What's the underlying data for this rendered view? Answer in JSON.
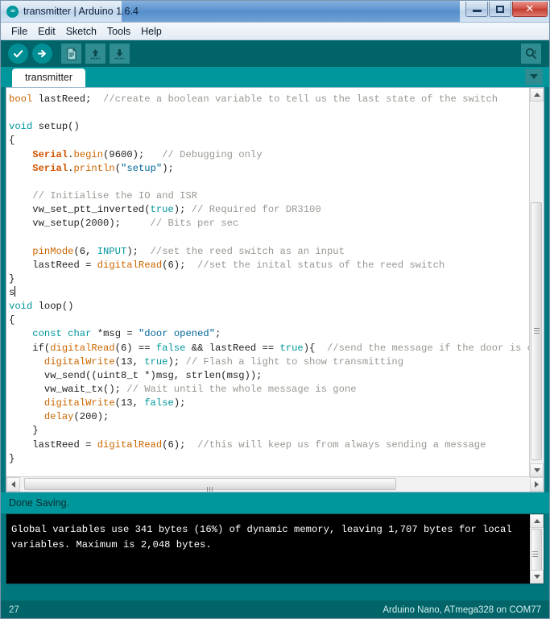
{
  "window": {
    "title": "transmitter | Arduino 1.6.4",
    "logo_icon": "arduino-infinity-logo",
    "minimize_label": "Minimize",
    "maximize_label": "Maximize",
    "close_label": "Close",
    "close_glyph": "✕"
  },
  "menubar": {
    "items": [
      {
        "label": "File"
      },
      {
        "label": "Edit"
      },
      {
        "label": "Sketch"
      },
      {
        "label": "Tools"
      },
      {
        "label": "Help"
      }
    ]
  },
  "toolbar": {
    "buttons": [
      {
        "name": "verify-button",
        "icon": "checkmark-icon",
        "tooltip": "Verify"
      },
      {
        "name": "upload-button",
        "icon": "right-arrow-icon",
        "tooltip": "Upload"
      },
      {
        "name": "new-button",
        "icon": "new-document-icon",
        "tooltip": "New"
      },
      {
        "name": "open-button",
        "icon": "up-arrow-icon",
        "tooltip": "Open"
      },
      {
        "name": "save-button",
        "icon": "down-arrow-icon",
        "tooltip": "Save"
      }
    ],
    "serial_monitor": {
      "icon": "magnifier-icon",
      "tooltip": "Serial Monitor"
    }
  },
  "tabs": {
    "items": [
      {
        "label": "transmitter",
        "active": true
      }
    ],
    "menu_icon": "chevron-down-icon"
  },
  "editor": {
    "lines": [
      [
        {
          "t": "bool",
          "c": "kw"
        },
        {
          "t": " lastReed;  ",
          "c": "plain"
        },
        {
          "t": "//create a boolean variable to tell us the last state of the switch",
          "c": "cmt"
        }
      ],
      [],
      [
        {
          "t": "void",
          "c": "kw2"
        },
        {
          "t": " setup()",
          "c": "plain"
        }
      ],
      [
        {
          "t": "{",
          "c": "plain"
        }
      ],
      [
        {
          "t": "    ",
          "c": "plain"
        },
        {
          "t": "Serial",
          "c": "fn"
        },
        {
          "t": ".",
          "c": "plain"
        },
        {
          "t": "begin",
          "c": "fnm"
        },
        {
          "t": "(9600);   ",
          "c": "plain"
        },
        {
          "t": "// Debugging only",
          "c": "cmt"
        }
      ],
      [
        {
          "t": "    ",
          "c": "plain"
        },
        {
          "t": "Serial",
          "c": "fn"
        },
        {
          "t": ".",
          "c": "plain"
        },
        {
          "t": "println",
          "c": "fnm"
        },
        {
          "t": "(",
          "c": "plain"
        },
        {
          "t": "\"setup\"",
          "c": "str"
        },
        {
          "t": ");",
          "c": "plain"
        }
      ],
      [],
      [
        {
          "t": "    ",
          "c": "plain"
        },
        {
          "t": "// Initialise the IO and ISR",
          "c": "cmt"
        }
      ],
      [
        {
          "t": "    vw_set_ptt_inverted(",
          "c": "plain"
        },
        {
          "t": "true",
          "c": "kw2"
        },
        {
          "t": "); ",
          "c": "plain"
        },
        {
          "t": "// Required for DR3100",
          "c": "cmt"
        }
      ],
      [
        {
          "t": "    vw_setup(2000);     ",
          "c": "plain"
        },
        {
          "t": "// Bits per sec",
          "c": "cmt"
        }
      ],
      [],
      [
        {
          "t": "    ",
          "c": "plain"
        },
        {
          "t": "pinMode",
          "c": "kw"
        },
        {
          "t": "(6, ",
          "c": "plain"
        },
        {
          "t": "INPUT",
          "c": "kw2"
        },
        {
          "t": ");  ",
          "c": "plain"
        },
        {
          "t": "//set the reed switch as an input",
          "c": "cmt"
        }
      ],
      [
        {
          "t": "    lastReed = ",
          "c": "plain"
        },
        {
          "t": "digitalRead",
          "c": "kw"
        },
        {
          "t": "(6);  ",
          "c": "plain"
        },
        {
          "t": "//set the inital status of the reed switch",
          "c": "cmt"
        }
      ],
      [
        {
          "t": "}",
          "c": "plain"
        }
      ],
      [
        {
          "t": "s",
          "c": "plain"
        },
        {
          "t": "|CARET|",
          "c": "caret"
        }
      ],
      [
        {
          "t": "void",
          "c": "kw2"
        },
        {
          "t": " loop()",
          "c": "plain"
        }
      ],
      [
        {
          "t": "{",
          "c": "plain"
        }
      ],
      [
        {
          "t": "    ",
          "c": "plain"
        },
        {
          "t": "const",
          "c": "kw2"
        },
        {
          "t": " ",
          "c": "plain"
        },
        {
          "t": "char",
          "c": "kw2"
        },
        {
          "t": " *msg = ",
          "c": "plain"
        },
        {
          "t": "\"door opened\"",
          "c": "str"
        },
        {
          "t": ";",
          "c": "plain"
        }
      ],
      [
        {
          "t": "    if(",
          "c": "plain"
        },
        {
          "t": "digitalRead",
          "c": "kw"
        },
        {
          "t": "(6) == ",
          "c": "plain"
        },
        {
          "t": "false",
          "c": "kw2"
        },
        {
          "t": " && lastReed == ",
          "c": "plain"
        },
        {
          "t": "true",
          "c": "kw2"
        },
        {
          "t": "){  ",
          "c": "plain"
        },
        {
          "t": "//send the message if the door is open,",
          "c": "cmt"
        }
      ],
      [
        {
          "t": "      ",
          "c": "plain"
        },
        {
          "t": "digitalWrite",
          "c": "kw"
        },
        {
          "t": "(13, ",
          "c": "plain"
        },
        {
          "t": "true",
          "c": "kw2"
        },
        {
          "t": "); ",
          "c": "plain"
        },
        {
          "t": "// Flash a light to show transmitting",
          "c": "cmt"
        }
      ],
      [
        {
          "t": "      vw_send((uint8_t *)msg, strlen(msg));",
          "c": "plain"
        }
      ],
      [
        {
          "t": "      vw_wait_tx(); ",
          "c": "plain"
        },
        {
          "t": "// Wait until the whole message is gone",
          "c": "cmt"
        }
      ],
      [
        {
          "t": "      ",
          "c": "plain"
        },
        {
          "t": "digitalWrite",
          "c": "kw"
        },
        {
          "t": "(13, ",
          "c": "plain"
        },
        {
          "t": "false",
          "c": "kw2"
        },
        {
          "t": ");",
          "c": "plain"
        }
      ],
      [
        {
          "t": "      ",
          "c": "plain"
        },
        {
          "t": "delay",
          "c": "kw"
        },
        {
          "t": "(200);",
          "c": "plain"
        }
      ],
      [
        {
          "t": "    }",
          "c": "plain"
        }
      ],
      [
        {
          "t": "    lastReed = ",
          "c": "plain"
        },
        {
          "t": "digitalRead",
          "c": "kw"
        },
        {
          "t": "(6);  ",
          "c": "plain"
        },
        {
          "t": "//this will keep us from always sending a message",
          "c": "cmt"
        }
      ],
      [
        {
          "t": "}",
          "c": "plain"
        }
      ]
    ],
    "vscroll": {
      "up_icon": "scroll-up-arrow-icon",
      "down_icon": "scroll-down-arrow-icon"
    },
    "hscroll": {
      "left_icon": "scroll-left-arrow-icon",
      "right_icon": "scroll-right-arrow-icon"
    }
  },
  "status_message": "Done Saving.",
  "console": {
    "text": "Global variables use 341 bytes (16%) of dynamic memory, leaving 1,707 bytes for local\nvariables. Maximum is 2,048 bytes."
  },
  "statusbar": {
    "line_number": "27",
    "board_info": "Arduino Nano, ATmega328 on COM77"
  },
  "colors": {
    "teal_primary": "#00979c",
    "teal_dark": "#006468",
    "teal_mid": "#00777d",
    "keyword_orange": "#cc6600",
    "keyword_teal": "#00979c",
    "comment_grey": "#989892",
    "string_blue": "#006699",
    "console_bg": "#000000"
  }
}
